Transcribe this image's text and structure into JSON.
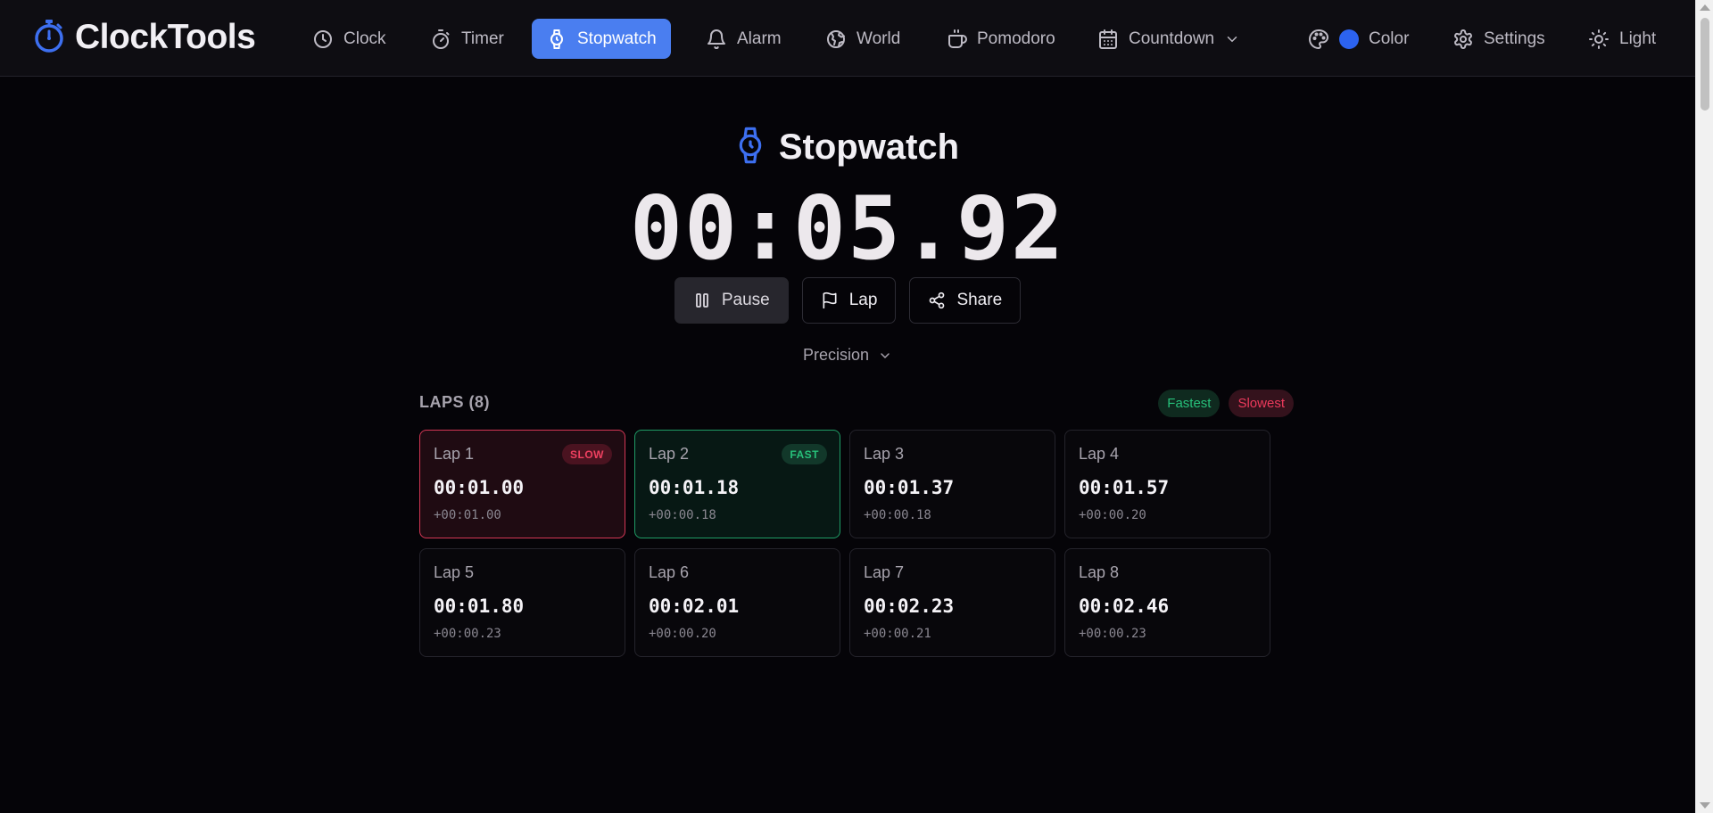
{
  "app": {
    "name": "ClockTools"
  },
  "nav": {
    "items": [
      {
        "label": "Clock",
        "icon": "clock-icon"
      },
      {
        "label": "Timer",
        "icon": "timer-icon"
      },
      {
        "label": "Stopwatch",
        "icon": "stopwatch-icon",
        "active": true
      },
      {
        "label": "Alarm",
        "icon": "bell-icon"
      },
      {
        "label": "World",
        "icon": "globe-icon"
      },
      {
        "label": "Pomodoro",
        "icon": "coffee-icon"
      },
      {
        "label": "Countdown",
        "icon": "calendar-icon"
      }
    ],
    "color_label": "Color",
    "color_value": "#2c63f0",
    "settings_label": "Settings",
    "theme_label": "Light"
  },
  "stopwatch": {
    "title": "Stopwatch",
    "time": "00:05.92",
    "pause_label": "Pause",
    "lap_label": "Lap",
    "share_label": "Share",
    "precision_label": "Precision"
  },
  "laps": {
    "header": "LAPS (8)",
    "legend_fastest": "Fastest",
    "legend_slowest": "Slowest",
    "items": [
      {
        "name": "Lap 1",
        "total": "00:01.00",
        "split": "+00:01.00",
        "badge": "SLOW"
      },
      {
        "name": "Lap 2",
        "total": "00:01.18",
        "split": "+00:00.18",
        "badge": "FAST"
      },
      {
        "name": "Lap 3",
        "total": "00:01.37",
        "split": "+00:00.18"
      },
      {
        "name": "Lap 4",
        "total": "00:01.57",
        "split": "+00:00.20"
      },
      {
        "name": "Lap 5",
        "total": "00:01.80",
        "split": "+00:00.23"
      },
      {
        "name": "Lap 6",
        "total": "00:02.01",
        "split": "+00:00.20"
      },
      {
        "name": "Lap 7",
        "total": "00:02.23",
        "split": "+00:00.21"
      },
      {
        "name": "Lap 8",
        "total": "00:02.46",
        "split": "+00:00.23"
      }
    ]
  },
  "colors": {
    "accent": "#4a7ef0",
    "fast": "#27c07a",
    "slow": "#ec3a5c"
  }
}
